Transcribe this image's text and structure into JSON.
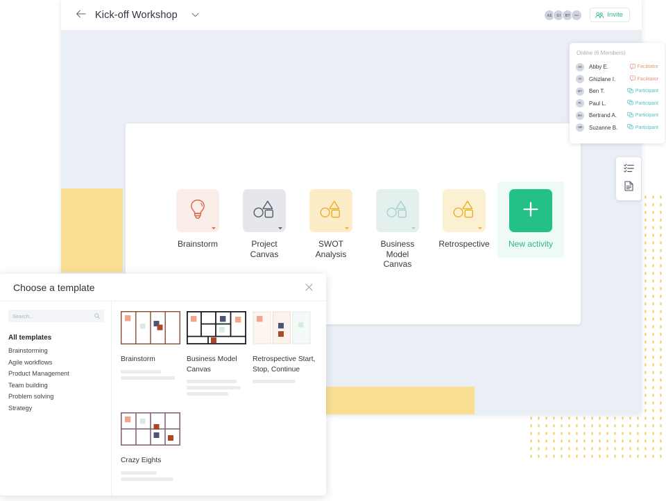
{
  "topbar": {
    "back_icon": "arrow-left-icon",
    "title": "Kick-off Workshop",
    "caret_icon": "chevron-down-icon",
    "avatars": [
      "AE",
      "GI",
      "BT",
      "•••"
    ],
    "invite_label": "Invite",
    "invite_icon": "people-add-icon",
    "accent_green": "#2eb87d"
  },
  "members_panel": {
    "title": "Online (6 Members)",
    "rows": [
      {
        "initials": "AE",
        "name": "Abby E.",
        "role": "Facilitator",
        "role_type": "facilitator"
      },
      {
        "initials": "GI",
        "name": "Ghizlane I.",
        "role": "Facilitator",
        "role_type": "facilitator"
      },
      {
        "initials": "BT",
        "name": "Ben T.",
        "role": "Participant",
        "role_type": "participant"
      },
      {
        "initials": "PL",
        "name": "Paul L.",
        "role": "Participant",
        "role_type": "participant"
      },
      {
        "initials": "BA",
        "name": "Bertrand A.",
        "role": "Participant",
        "role_type": "participant"
      },
      {
        "initials": "SB",
        "name": "Suzanne B.",
        "role": "Participant",
        "role_type": "participant"
      }
    ],
    "facilitator_color": "#e89585",
    "participant_color": "#4fc2bb"
  },
  "board": {
    "activities": [
      {
        "label": "Brainstorm",
        "icon": "lightbulb-icon",
        "bg": "#fbeee9",
        "fg": "#d96a4e",
        "has_caret": true,
        "selected": false
      },
      {
        "label": "Project\nCanvas",
        "icon": "shapes-icon",
        "bg": "#e6e7ea",
        "fg": "#53586a",
        "has_caret": true,
        "selected": false
      },
      {
        "label": "SWOT\nAnalysis",
        "icon": "shapes-icon",
        "bg": "#fcecc8",
        "fg": "#e5b125",
        "has_caret": true,
        "selected": false
      },
      {
        "label": "Business\nModel\nCanvas",
        "icon": "shapes-icon",
        "bg": "#e4f0ee",
        "fg": "#a9cfca",
        "has_caret": true,
        "selected": false
      },
      {
        "label": "Retrospective",
        "icon": "shapes-icon",
        "bg": "#fcf0d2",
        "fg": "#e5b125",
        "has_caret": true,
        "selected": false
      },
      {
        "label": "New activity",
        "icon": "plus-icon",
        "bg": "#23c087",
        "fg": "#ffffff",
        "has_caret": false,
        "selected": true
      }
    ]
  },
  "mini_toolbar": {
    "items": [
      {
        "icon": "checklist-icon",
        "name": "agenda-tool"
      },
      {
        "icon": "document-icon",
        "name": "notes-tool"
      }
    ]
  },
  "template_modal": {
    "title": "Choose a template",
    "close_icon": "close-icon",
    "search": {
      "placeholder": "Search...",
      "value": "",
      "icon": "search-icon"
    },
    "categories": [
      {
        "label": "All templates",
        "active": true
      },
      {
        "label": "Brainstorming",
        "active": false
      },
      {
        "label": "Agile workflows",
        "active": false
      },
      {
        "label": "Product Management",
        "active": false
      },
      {
        "label": "Team building",
        "active": false
      },
      {
        "label": "Problem solving",
        "active": false
      },
      {
        "label": "Strategy",
        "active": false
      }
    ],
    "templates": [
      {
        "name": "Brainstorm",
        "thumb": "brainstorm-thumb",
        "lines": [
          58,
          78
        ]
      },
      {
        "name": "Business Model Canvas",
        "thumb": "bmc-thumb",
        "lines": [
          72,
          78,
          60
        ]
      },
      {
        "name": "Retrospective Start, Stop, Continue",
        "thumb": "retro-thumb",
        "lines": [
          62
        ]
      },
      {
        "name": "Crazy Eights",
        "thumb": "crazy-eights-thumb",
        "lines": [
          52,
          76
        ]
      }
    ]
  },
  "canvas": {
    "bg_color": "#eaeef5",
    "sticky_yellow": "#fadf93",
    "dot_color": "#f0c330"
  }
}
